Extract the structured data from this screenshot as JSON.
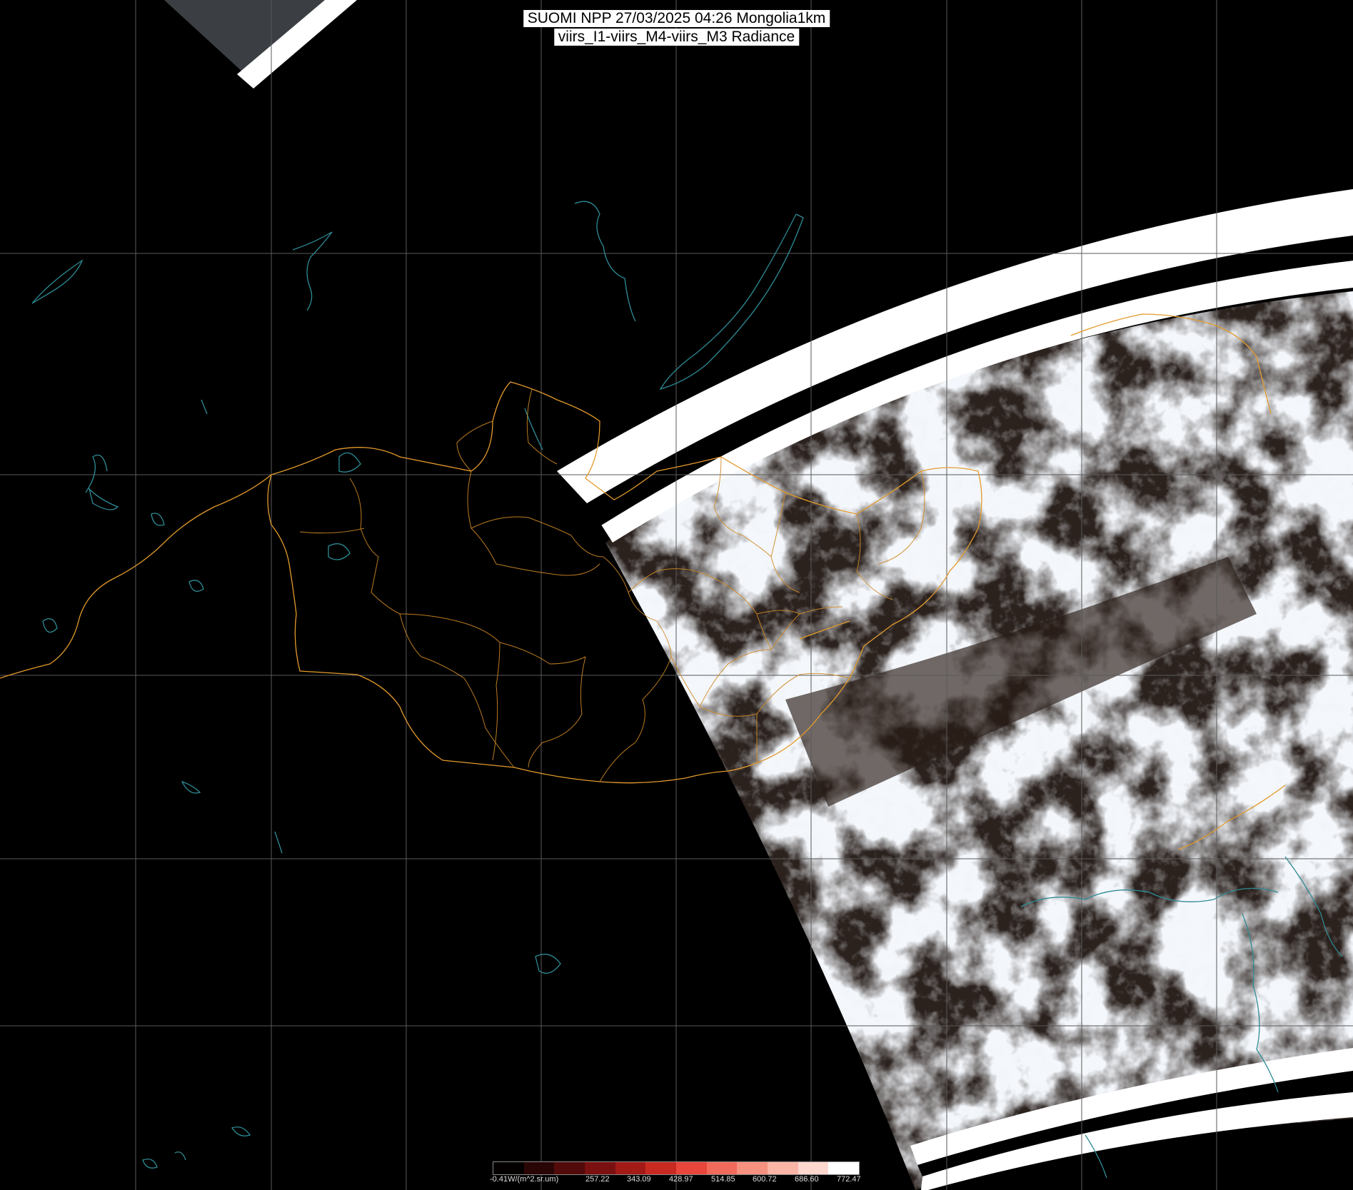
{
  "title": {
    "line1": "SUOMI NPP 27/03/2025 04:26 Mongolia1km",
    "line2": "viirs_I1-viirs_M4-viirs_M3 Radiance"
  },
  "colorbar": {
    "unit_label": "-0.41W/(m^2.sr.um)",
    "ticks": [
      "257.22",
      "343.09",
      "428.97",
      "514.85",
      "600.72",
      "686.60",
      "772.47"
    ],
    "colors": [
      "#050000",
      "#2a0505",
      "#520a0a",
      "#7a1010",
      "#a31a16",
      "#c82a22",
      "#e8463a",
      "#f26a5c",
      "#f6907f",
      "#f9b5a6",
      "#fcd8cf",
      "#ffffff"
    ]
  },
  "colors": {
    "background": "#000000",
    "grid": "#5a5a5a",
    "border": "#e39a2c",
    "water": "#2e8b95",
    "swath_stripe": "#ffffff",
    "cloud": "#e6eef6",
    "land": "#2a211d"
  },
  "map": {
    "projection_grid": true,
    "layers": [
      "satellite-swath",
      "country-borders",
      "province-borders",
      "lakes-rivers",
      "lat-lon-grid"
    ]
  }
}
